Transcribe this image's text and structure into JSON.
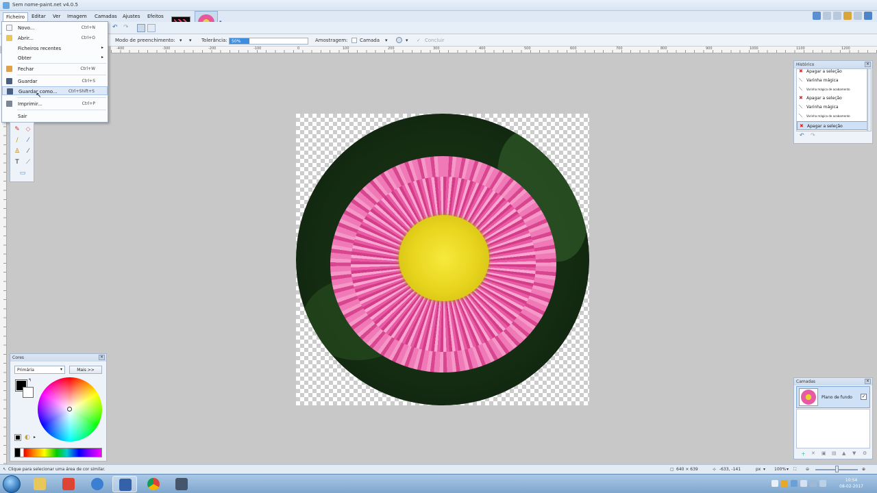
{
  "window": {
    "title": "Sem nome-paint.net v4.0.5"
  },
  "menubar": {
    "items": [
      "Ficheiro",
      "Editar",
      "Ver",
      "Imagem",
      "Camadas",
      "Ajustes",
      "Efeitos"
    ]
  },
  "file_menu": {
    "items": [
      {
        "label": "Novo...",
        "shortcut": "Ctrl+N",
        "icon": "new-file-icon"
      },
      {
        "label": "Abrir...",
        "shortcut": "Ctrl+O",
        "icon": "open-folder-icon"
      },
      {
        "label": "Ficheiros recentes",
        "shortcut": "",
        "icon": "",
        "submenu": true
      },
      {
        "label": "Obter",
        "shortcut": "",
        "icon": "",
        "submenu": true
      },
      {
        "label": "Fechar",
        "shortcut": "Ctrl+W",
        "icon": "close-file-icon"
      },
      {
        "label": "Guardar",
        "shortcut": "Ctrl+S",
        "icon": "save-icon"
      },
      {
        "label": "Guardar como...",
        "shortcut": "Ctrl+Shift+S",
        "icon": "save-as-icon",
        "highlighted": true
      },
      {
        "label": "Imprimir...",
        "shortcut": "Ctrl+P",
        "icon": "print-icon"
      },
      {
        "label": "Sair",
        "shortcut": "",
        "icon": ""
      }
    ]
  },
  "options_bar": {
    "fill_mode_label": "Modo de preenchimento:",
    "tolerance_label": "Tolerância:",
    "tolerance_value": "50%",
    "tolerance_fraction": 0.5,
    "sampling_label": "Amostragem:",
    "sampling_value": "Camada",
    "finish_label": "Concluir"
  },
  "ruler": {
    "labels": [
      "-400",
      "-300",
      "-200",
      "-100",
      "0",
      "100",
      "200",
      "300",
      "400",
      "500",
      "600",
      "700",
      "800",
      "900",
      "1000",
      "1100",
      "1200"
    ]
  },
  "colors_panel": {
    "title": "Cores",
    "mode_select": "Primária",
    "more_button": "Mais >>",
    "primary_color": "#000000",
    "secondary_color": "#ffffff"
  },
  "history_panel": {
    "title": "Histórico",
    "items": [
      {
        "label": "Apagar a seleção",
        "icon": "delete-x-icon",
        "small": false
      },
      {
        "label": "Varinha mágica",
        "icon": "magic-wand-icon",
        "small": false
      },
      {
        "label": "Varinha mágica de acabamento",
        "icon": "magic-wand-icon",
        "small": true
      },
      {
        "label": "Apagar a seleção",
        "icon": "delete-x-icon",
        "small": false
      },
      {
        "label": "Varinha mágica",
        "icon": "magic-wand-icon",
        "small": false
      },
      {
        "label": "Varinha mágica de acabamento",
        "icon": "magic-wand-icon",
        "small": true
      },
      {
        "label": "Apagar a seleção",
        "icon": "delete-x-icon",
        "small": false,
        "selected": true
      }
    ]
  },
  "layers_panel": {
    "title": "Camadas",
    "layers": [
      {
        "name": "Plano de fundo",
        "visible": true
      }
    ]
  },
  "status_bar": {
    "hint": "Clique para selecionar uma área de cor similar.",
    "image_size": "640 × 639",
    "cursor_pos": "-633, -141",
    "unit": "px",
    "zoom": "100%"
  },
  "taskbar": {
    "time": "10:54",
    "date": "08-02-2017",
    "apps": [
      "explorer-icon",
      "paint-net-icon",
      "internet-explorer-icon",
      "paint-tool-icon",
      "chrome-icon",
      "monitor-icon"
    ]
  },
  "colors": {
    "accent": "#3d8ee0",
    "menu_bg": "#dfe9f5",
    "canvas_bg": "#c8c8c8"
  }
}
